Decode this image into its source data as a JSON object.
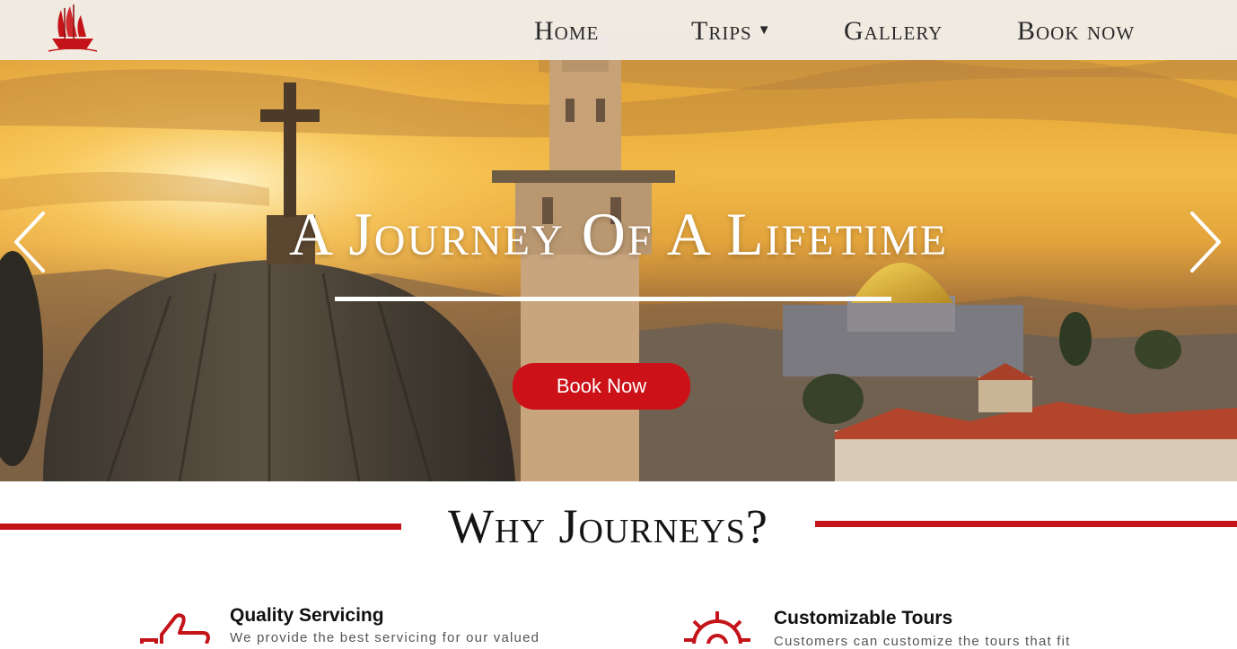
{
  "nav": {
    "items": [
      {
        "label": "Home"
      },
      {
        "label": "Trips",
        "has_dropdown": true
      },
      {
        "label": "Gallery"
      },
      {
        "label": "Book now"
      }
    ],
    "dropdown_caret": "▼",
    "logo_icon": "sailing-ship-logo"
  },
  "hero": {
    "title": "A Journey Of A Lifetime",
    "button_label": "Book Now",
    "prev_icon": "chevron-left-icon",
    "next_icon": "chevron-right-icon"
  },
  "why": {
    "title": "Why Journeys?",
    "features": [
      {
        "icon": "thumbs-up-icon",
        "title": "Quality Servicing",
        "description": "We provide the best servicing for our valued"
      },
      {
        "icon": "gear-icon",
        "title": "Customizable Tours",
        "description": "Customers can customize the tours that fit"
      }
    ]
  },
  "colors": {
    "accent_red": "#c4141a",
    "button_red": "#cc1118",
    "nav_bg": "#f2f0ee",
    "hero_text": "#ffffff"
  }
}
